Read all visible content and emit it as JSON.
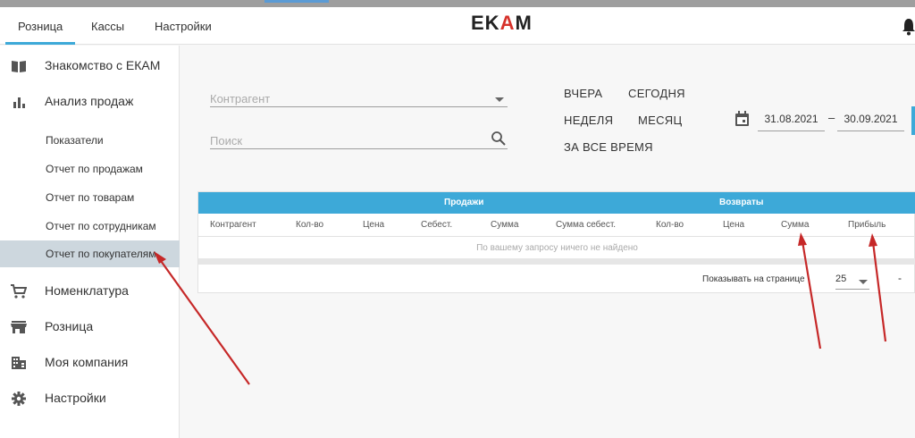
{
  "header": {
    "tabs": [
      {
        "label": "Розница",
        "active": true
      },
      {
        "label": "Кассы",
        "active": false
      },
      {
        "label": "Настройки",
        "active": false
      }
    ],
    "logo": {
      "part1": "EK",
      "part2": "A",
      "part3": "M"
    }
  },
  "sidebar": {
    "items": [
      {
        "label": "Знакомство с ЕКАМ",
        "icon": "book-icon"
      },
      {
        "label": "Анализ продаж",
        "icon": "bar-chart-icon"
      },
      {
        "label": "Номенклатура",
        "icon": "cart-icon"
      },
      {
        "label": "Розница",
        "icon": "store-icon"
      },
      {
        "label": "Моя компания",
        "icon": "building-icon"
      },
      {
        "label": "Настройки",
        "icon": "gear-icon"
      }
    ],
    "subitems": [
      {
        "label": "Показатели"
      },
      {
        "label": "Отчет по продажам"
      },
      {
        "label": "Отчет по товарам"
      },
      {
        "label": "Отчет по сотрудникам"
      },
      {
        "label": "Отчет по покупателям",
        "selected": true
      }
    ]
  },
  "filters": {
    "counterparty_placeholder": "Контрагент",
    "search_placeholder": "Поиск",
    "periods": {
      "yesterday": "ВЧЕРА",
      "today": "СЕГОДНЯ",
      "week": "НЕДЕЛЯ",
      "month": "МЕСЯЦ",
      "all_time": "ЗА ВСЕ ВРЕМЯ"
    },
    "date_from": "31.08.2021",
    "date_separator": "–",
    "date_to": "30.09.2021"
  },
  "table": {
    "group_sales": "Продажи",
    "group_returns": "Возвраты",
    "columns": [
      "Контрагент",
      "Кол-во",
      "Цена",
      "Себест.",
      "Сумма",
      "Сумма себест.",
      "Кол-во",
      "Цена",
      "Сумма",
      "Прибыль"
    ],
    "empty_message": "По вашему запросу ничего не найдено",
    "pager_label": "Показывать на странице",
    "pager_value": "25",
    "pager_dash": "-"
  },
  "colors": {
    "accent": "#3da9d8",
    "arrow": "#c62828",
    "selected_bg": "#cdd7de"
  }
}
